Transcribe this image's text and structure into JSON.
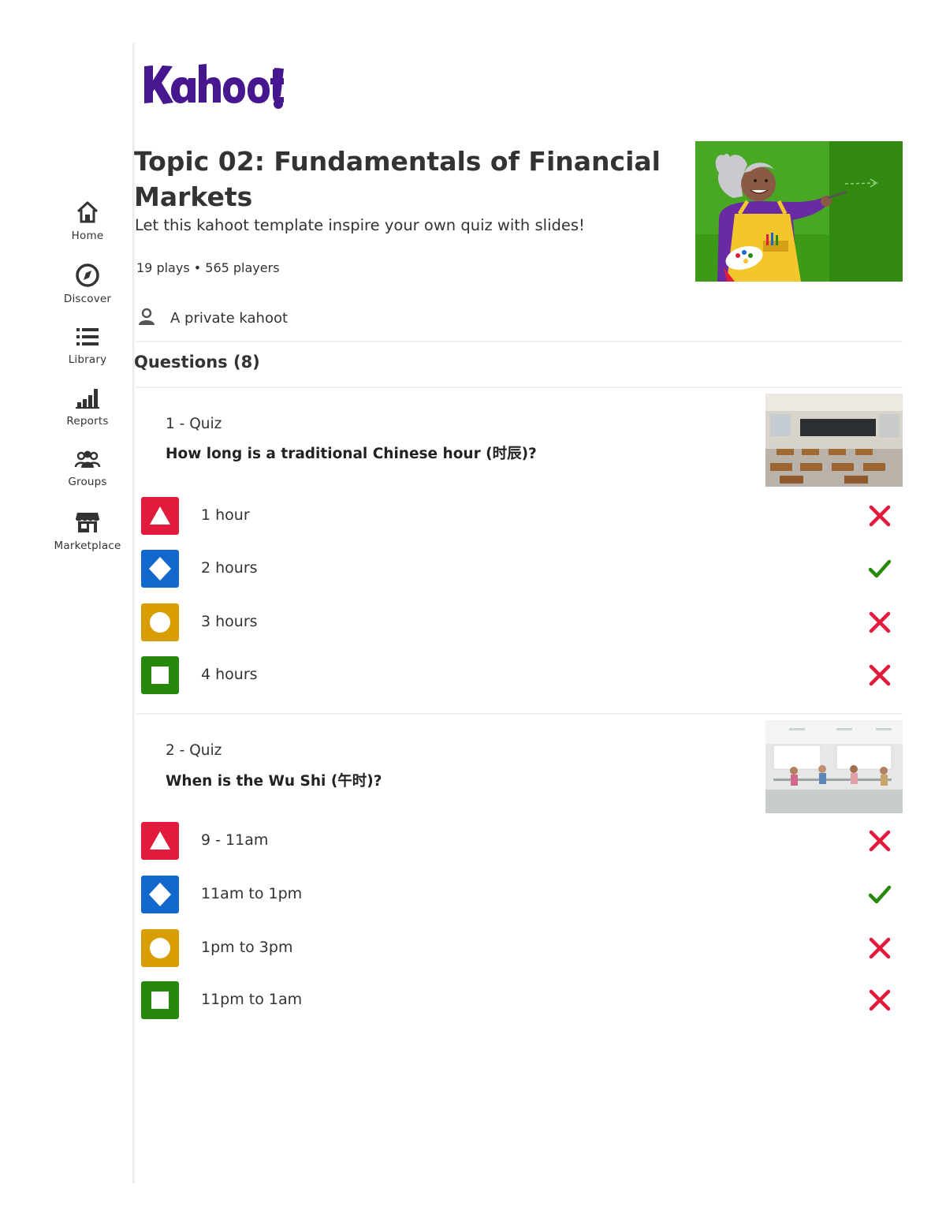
{
  "brand": {
    "logo_text": "Kahoot!",
    "logo_color": "#46178f"
  },
  "sidebar": {
    "items": [
      {
        "label": "Home",
        "icon": "home-icon"
      },
      {
        "label": "Discover",
        "icon": "compass-icon"
      },
      {
        "label": "Library",
        "icon": "list-icon"
      },
      {
        "label": "Reports",
        "icon": "bar-chart-icon"
      },
      {
        "label": "Groups",
        "icon": "groups-icon"
      },
      {
        "label": "Marketplace",
        "icon": "store-icon"
      }
    ]
  },
  "kahoot": {
    "title": "Topic 02: Fundamentals of Financial Markets",
    "description": "Let this kahoot template inspire your own quiz with slides!",
    "stats": "19 plays • 565 players",
    "visibility": "A private kahoot",
    "cover_bg": "#3d9a17"
  },
  "questions_heading": "Questions (8)",
  "questions": [
    {
      "number_label": "1 - Quiz",
      "text": "How long is a traditional Chinese hour (时辰)?",
      "answers": [
        {
          "text": "1 hour",
          "shape": "triangle",
          "correct": false
        },
        {
          "text": "2 hours",
          "shape": "diamond",
          "correct": true
        },
        {
          "text": "3 hours",
          "shape": "circle",
          "correct": false
        },
        {
          "text": "4 hours",
          "shape": "square",
          "correct": false
        }
      ]
    },
    {
      "number_label": "2 - Quiz",
      "text": "When is the Wu Shi (午时)?",
      "answers": [
        {
          "text": "9 - 11am",
          "shape": "triangle",
          "correct": false
        },
        {
          "text": "11am to 1pm",
          "shape": "diamond",
          "correct": true
        },
        {
          "text": "1pm to 3pm",
          "shape": "circle",
          "correct": false
        },
        {
          "text": "11pm to 1am",
          "shape": "square",
          "correct": false
        }
      ]
    }
  ],
  "colors": {
    "triangle": "#e21b3c",
    "diamond": "#1368ce",
    "circle": "#d89e00",
    "square": "#26890c",
    "correct": "#26890c",
    "incorrect": "#e21b3c"
  }
}
